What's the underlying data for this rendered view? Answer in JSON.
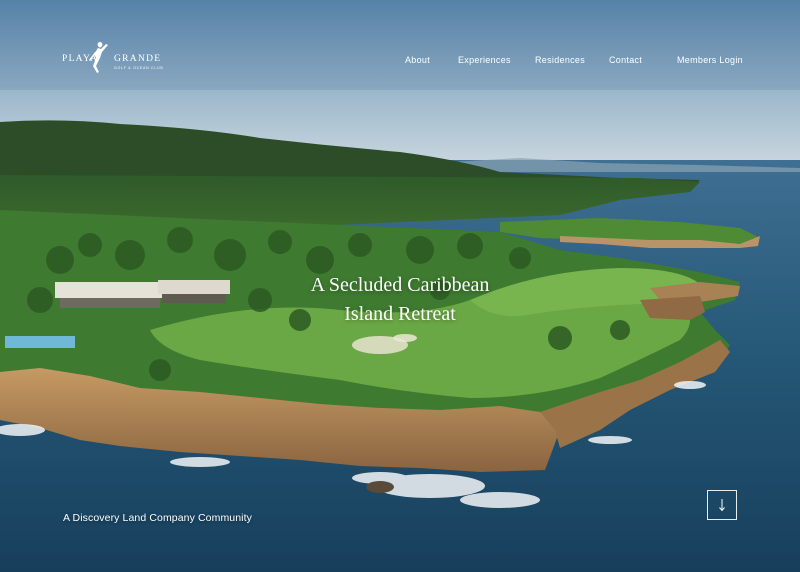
{
  "brand": {
    "name_left": "PLAYA",
    "name_right": "GRANDE",
    "tagline": "GOLF & OCEAN CLUB",
    "logo_icon": "golfer-silhouette-icon"
  },
  "nav": {
    "items": [
      {
        "label": "About"
      },
      {
        "label": "Experiences"
      },
      {
        "label": "Residences"
      },
      {
        "label": "Contact"
      },
      {
        "label": "Members Login"
      }
    ]
  },
  "hero": {
    "headline_line1": "A Secluded Caribbean",
    "headline_line2": "Island Retreat",
    "community": "A Discovery Land Company Community",
    "scroll_icon": "arrow-down-icon"
  },
  "colors": {
    "sky_top": "#5f8bb0",
    "sky_horizon": "#c9d8e2",
    "ocean": "#1f4d70",
    "fairway": "#5d9a3c",
    "cliff": "#b08a5a"
  }
}
